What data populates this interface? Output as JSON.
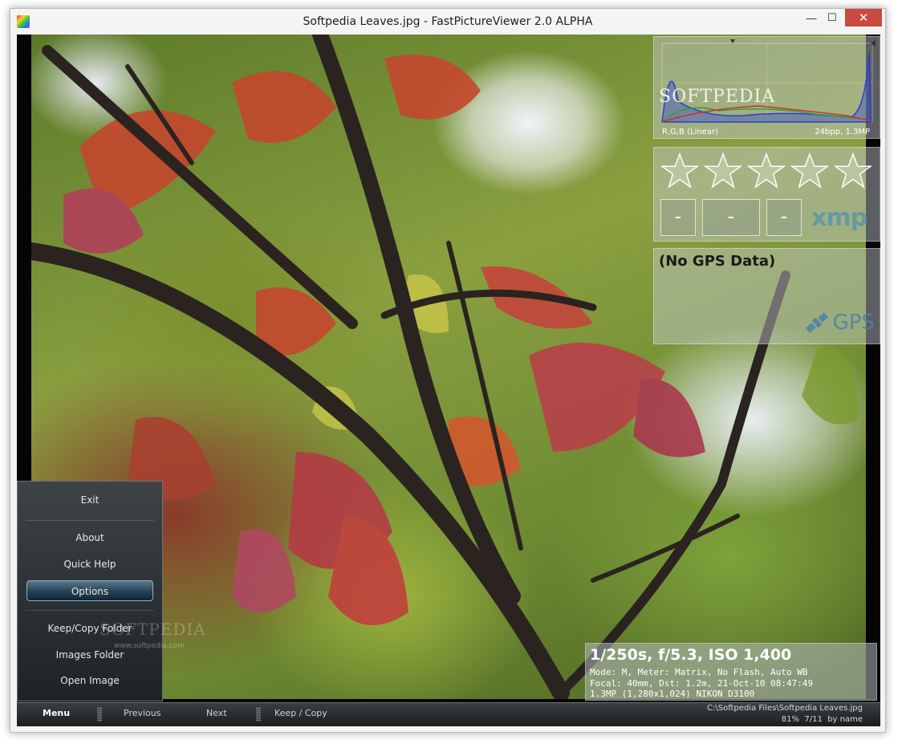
{
  "window": {
    "title": "Softpedia Leaves.jpg - FastPictureViewer 2.0 ALPHA",
    "minimize_glyph": "—",
    "maximize_glyph": "☐",
    "close_glyph": "✕"
  },
  "histogram": {
    "channels_label": "R,G,B (Linear)",
    "info_label": "24bpp, 1.3MP",
    "watermark": "SOFTPEDIA"
  },
  "rating": {
    "stars": 5,
    "star_filled": 0,
    "box_labels": [
      "-",
      "-",
      "-"
    ],
    "xmp_label": "xmp"
  },
  "gps": {
    "title": "(No GPS Data)",
    "logo_label": "GPS"
  },
  "menu": {
    "items": [
      {
        "label": "Exit"
      },
      {
        "label": "About"
      },
      {
        "label": "Quick Help"
      },
      {
        "label": "Options",
        "selected": true
      },
      {
        "label": "Keep/Copy Folder"
      },
      {
        "label": "Images Folder"
      },
      {
        "label": "Open Image"
      }
    ],
    "watermark": "SOFTPEDIA",
    "url": "www.softpedia.com"
  },
  "exif": {
    "main": "1/250s, f/5.3, ISO 1,400",
    "line1": "Mode: M, Meter: Matrix, No Flash, Auto WB",
    "line2": "Focal: 40mm, Dst: 1.2m, 21-Oct-10 08:47:49",
    "line3": "1.3MP (1,280x1,024) NIKON D3100"
  },
  "bottombar": {
    "menu_label": "Menu",
    "previous_label": "Previous",
    "next_label": "Next",
    "keep_copy_label": "Keep / Copy",
    "path": "C:\\Softpedia Files\\Softpedia Leaves.jpg",
    "zoom": "81%",
    "position": "7/11",
    "sort": "by name"
  },
  "colors": {
    "menu_bg": "#2a2f32",
    "selected_bg": "#2a4558",
    "close_button": "#c94a3f"
  }
}
